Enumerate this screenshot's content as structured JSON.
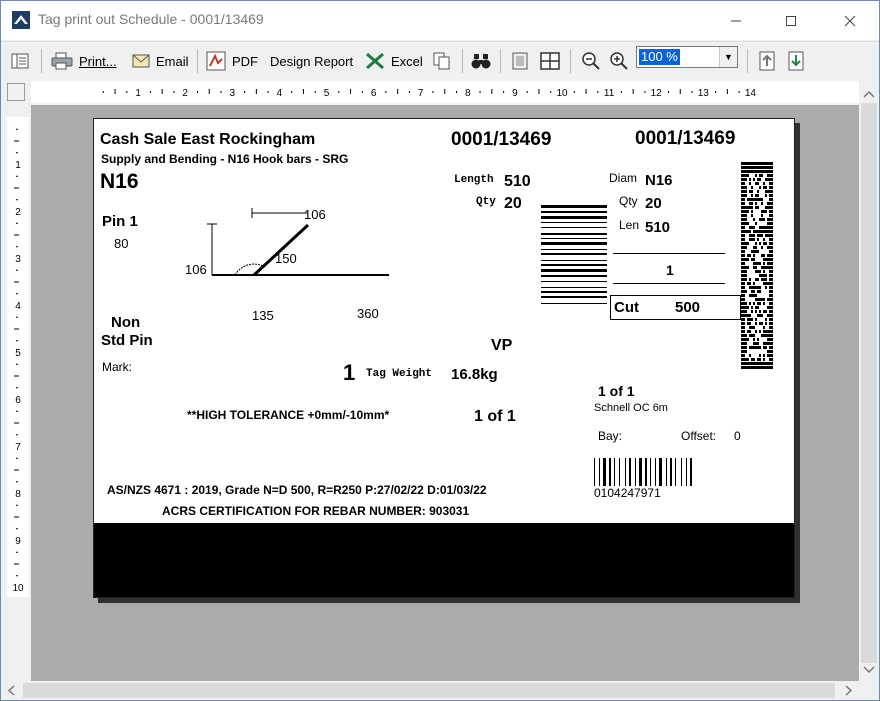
{
  "window": {
    "title": "Tag print out Schedule - 0001/13469"
  },
  "toolbar": {
    "print_label": "Print...",
    "email_label": "Email",
    "pdf_label": "PDF",
    "design_report_label": "Design Report",
    "excel_label": "Excel",
    "zoom_value": "100 %"
  },
  "ruler": {
    "h_ticks": [
      "1",
      "2",
      "3",
      "4",
      "5",
      "6",
      "7",
      "8",
      "9",
      "10",
      "11",
      "12",
      "13",
      "14"
    ],
    "v_ticks": [
      "1",
      "2",
      "3",
      "4",
      "5",
      "6",
      "7",
      "8",
      "9",
      "10"
    ]
  },
  "tag": {
    "customer": "Cash  Sale East Rockingham",
    "description": "Supply and Bending - N16 Hook bars - SRG",
    "bar_size": "N16",
    "tag_number_center": "0001/13469",
    "tag_number_right": "0001/13469",
    "length_label": "Length",
    "length_value": "510",
    "qty_label": "Qty",
    "qty_value": "20",
    "pin_label": "Pin 1",
    "pin_value": "80",
    "shape": {
      "dim_top": "106",
      "dim_left": "106",
      "dim_diag": "150",
      "angle": "135",
      "base": "360"
    },
    "non_std_pin_line1": "Non",
    "non_std_pin_line2": "Std Pin",
    "mark_label": "Mark:",
    "vp": "VP",
    "count": "1",
    "tag_weight_label": "Tag Weight",
    "tag_weight_value": "16.8kg",
    "tolerance": "**HIGH TOLERANCE +0mm/-10mm*",
    "of_center": "1  of  1",
    "standard_line": "AS/NZS 4671 : 2019,   Grade N=D 500,    R=R250    P:27/02/22  D:01/03/22",
    "acrs_line": "ACRS CERTIFICATION FOR REBAR NUMBER:  903031",
    "right_panel": {
      "diam_label": "Diam",
      "diam_value": "N16",
      "qty_label": "Qty",
      "qty_value": "20",
      "len_label": "Len",
      "len_value": "510",
      "bundle": "1",
      "cut_label": "Cut",
      "cut_value": "500",
      "of_right": "1  of  1",
      "machine": "Schnell OC 6m",
      "bay_label": "Bay:",
      "offset_label": "Offset:",
      "offset_value": "0",
      "barcode_number": "0104247971"
    }
  }
}
